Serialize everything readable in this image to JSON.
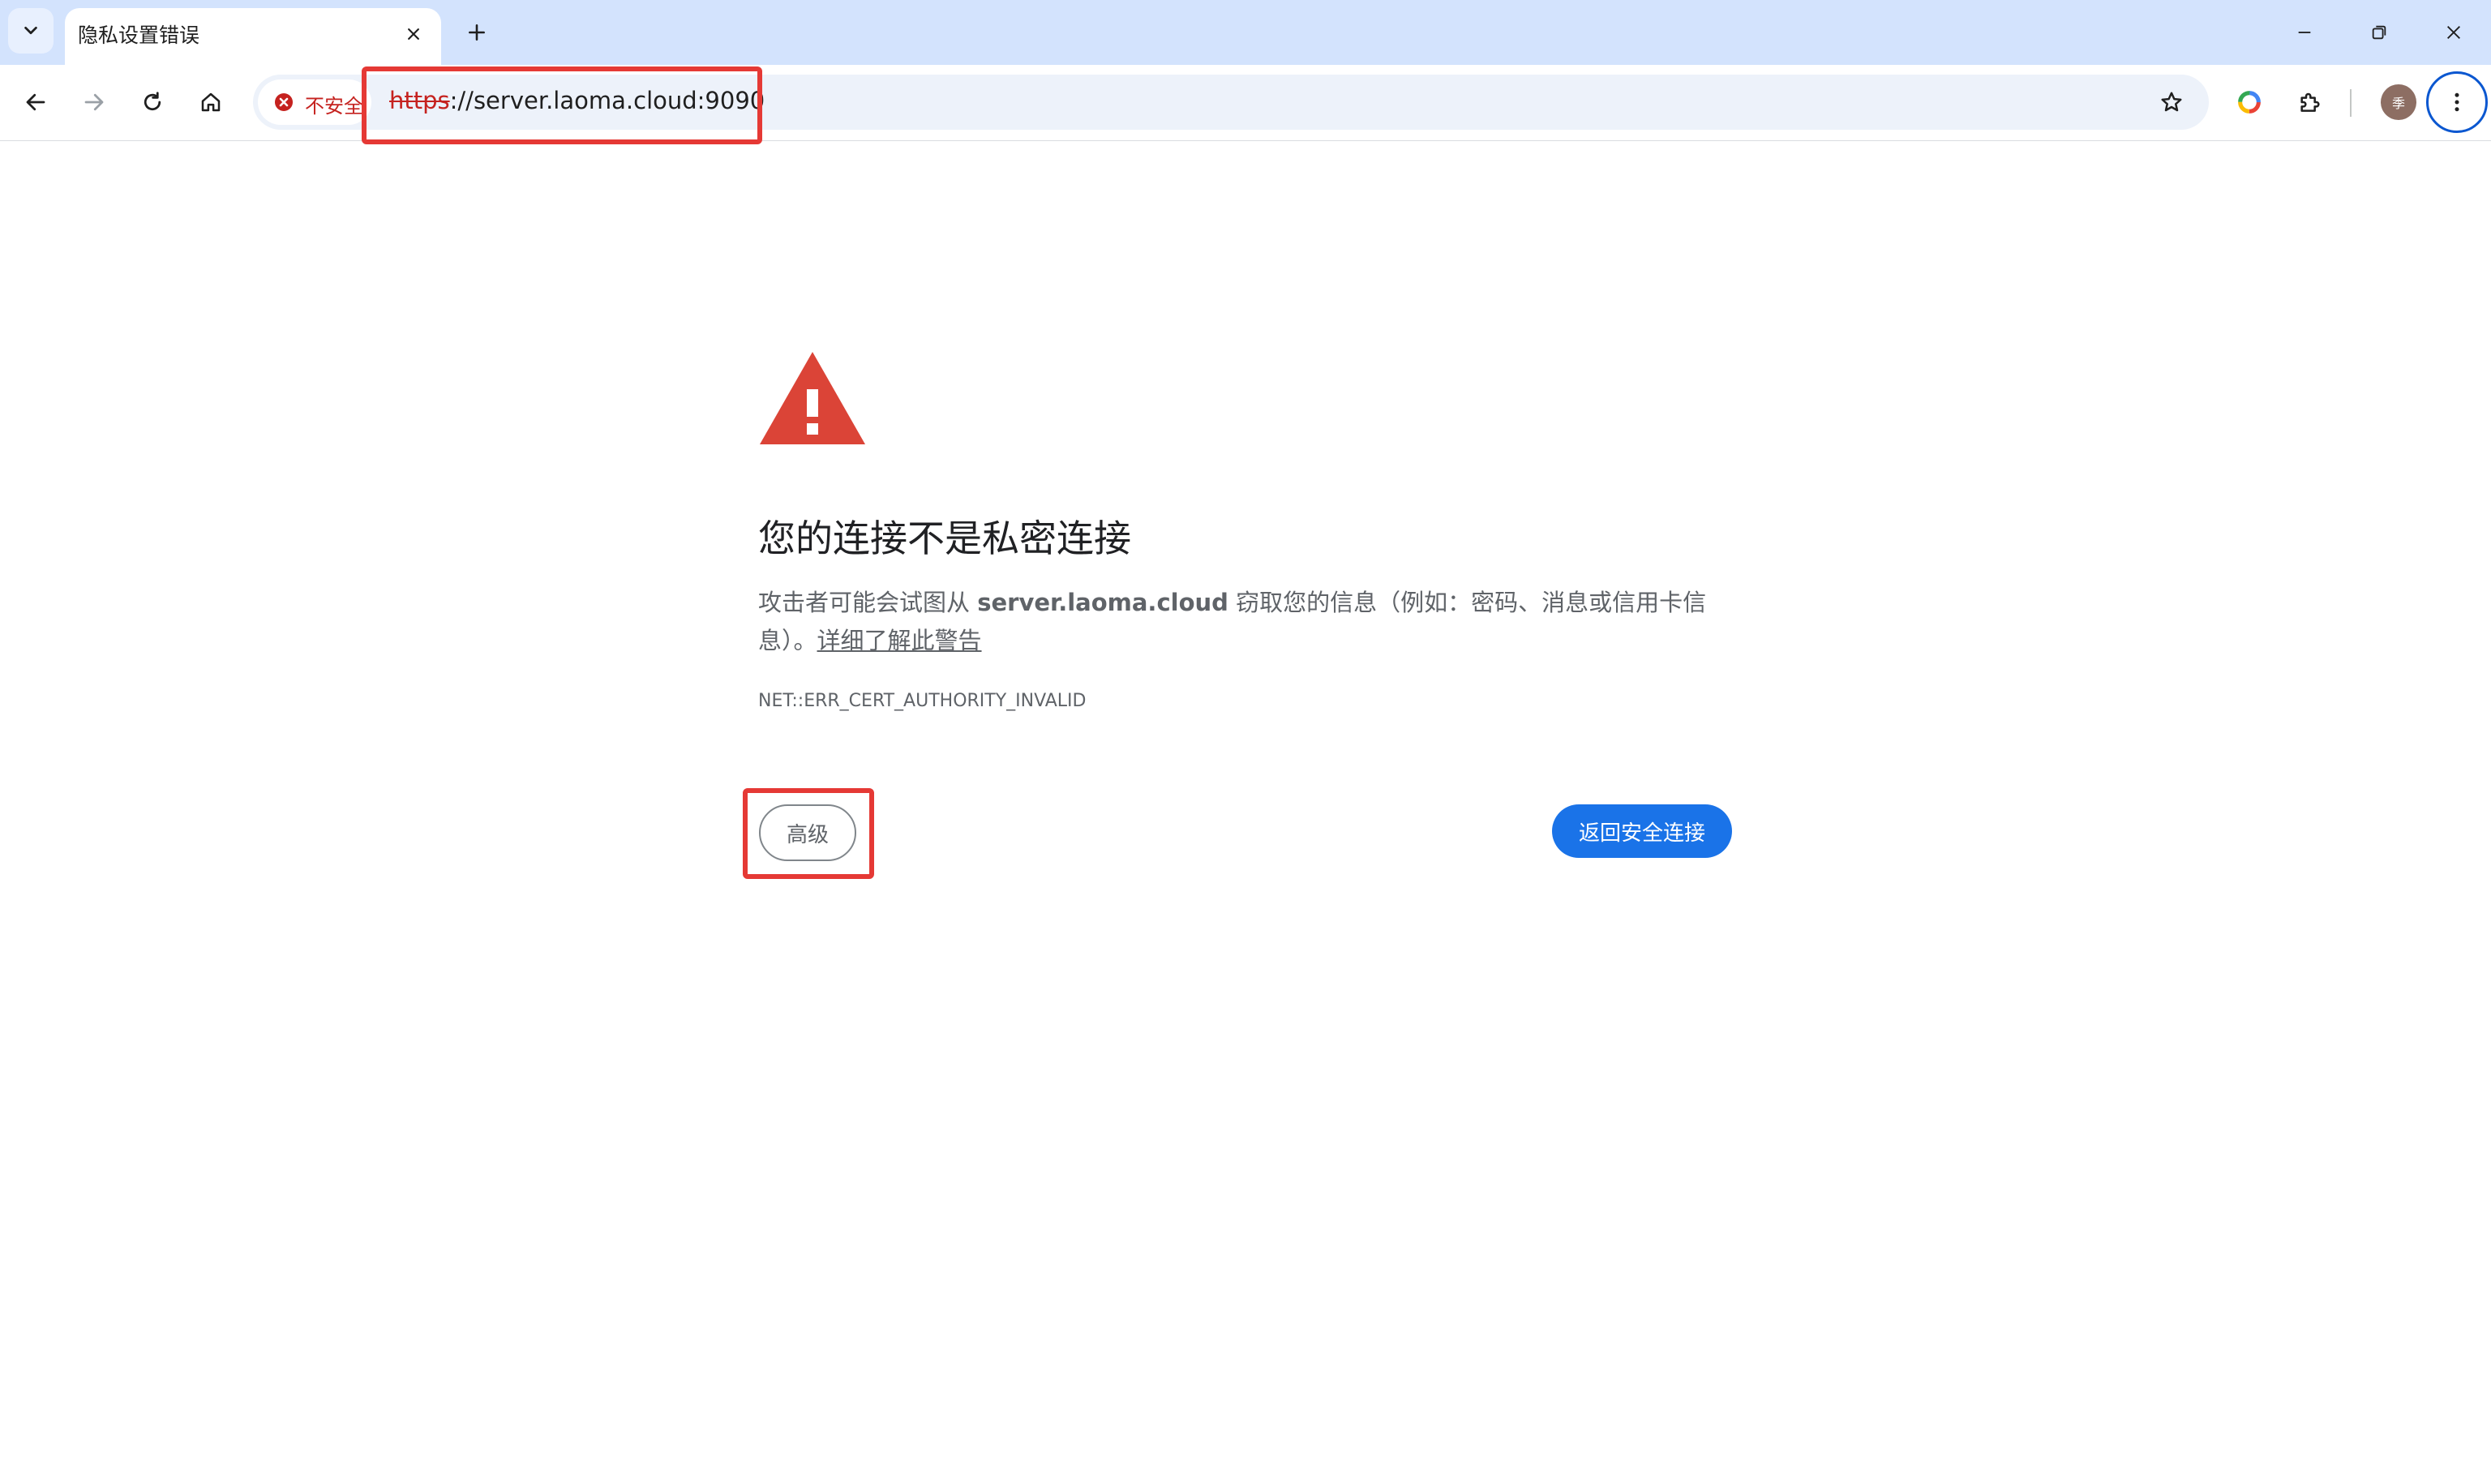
{
  "tab": {
    "title": "隐私设置错误"
  },
  "omnibox": {
    "security_label": "不安全",
    "url_scheme": "https",
    "url_rest": "://server.laoma.cloud:9090"
  },
  "profile": {
    "avatar_label": "季"
  },
  "interstitial": {
    "heading": "您的连接不是私密连接",
    "explanation_before": "攻击者可能会试图从 ",
    "hostname": "server.laoma.cloud",
    "explanation_after": " 窃取您的信息（例如：密码、消息或信用卡信息）。",
    "learn_more": "详细了解此警告",
    "error_code": "NET::ERR_CERT_AUTHORITY_INVALID",
    "advanced_button": "高级",
    "back_button": "返回安全连接"
  },
  "icons": {
    "tab_search": "chevron-down-icon",
    "tab_close": "close-icon",
    "new_tab": "plus-icon",
    "minimize": "minimize-icon",
    "restore": "restore-icon",
    "close_window": "close-icon",
    "back": "arrow-left-icon",
    "forward": "arrow-right-icon",
    "reload": "reload-icon",
    "home": "home-icon",
    "not_secure": "error-circle-icon",
    "bookmark": "star-icon",
    "google": "google-icon",
    "extensions": "puzzle-icon",
    "menu": "kebab-menu-icon",
    "warning": "warning-triangle-icon"
  },
  "colors": {
    "tabstrip_bg": "#d3e3fd",
    "danger": "#c5221f",
    "primary_button": "#1a73e8",
    "warning_icon": "#db4437",
    "highlight": "#e53935"
  }
}
